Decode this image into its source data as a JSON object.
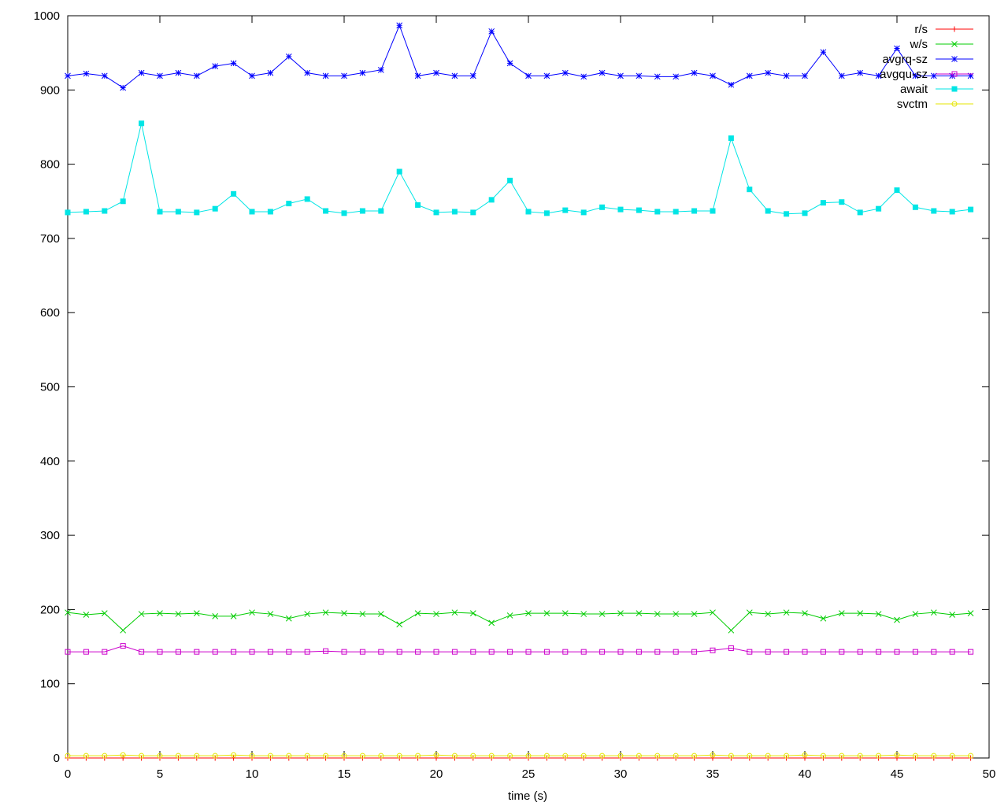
{
  "chart_data": {
    "type": "line",
    "title": "",
    "xlabel": "time (s)",
    "ylabel": "",
    "xlim": [
      0,
      50
    ],
    "ylim": [
      0,
      1000
    ],
    "xticks": [
      0,
      5,
      10,
      15,
      20,
      25,
      30,
      35,
      40,
      45,
      50
    ],
    "yticks": [
      0,
      100,
      200,
      300,
      400,
      500,
      600,
      700,
      800,
      900,
      1000
    ],
    "grid": false,
    "legend_position": "top-right",
    "x": [
      0,
      1,
      2,
      3,
      4,
      5,
      6,
      7,
      8,
      9,
      10,
      11,
      12,
      13,
      14,
      15,
      16,
      17,
      18,
      19,
      20,
      21,
      22,
      23,
      24,
      25,
      26,
      27,
      28,
      29,
      30,
      31,
      32,
      33,
      34,
      35,
      36,
      37,
      38,
      39,
      40,
      41,
      42,
      43,
      44,
      45,
      46,
      47,
      48,
      49
    ],
    "series": [
      {
        "name": "r/s",
        "color": "#ff0000",
        "marker": "plus",
        "values": [
          0,
          0,
          0,
          0,
          0,
          0,
          0,
          0,
          0,
          0,
          0,
          0,
          0,
          0,
          0,
          0,
          0,
          0,
          0,
          0,
          0,
          0,
          0,
          0,
          0,
          0,
          0,
          0,
          0,
          0,
          0,
          0,
          0,
          0,
          0,
          0,
          0,
          0,
          0,
          0,
          0,
          0,
          0,
          0,
          0,
          0,
          0,
          0,
          0,
          0
        ]
      },
      {
        "name": "w/s",
        "color": "#00cc00",
        "marker": "x",
        "values": [
          196,
          193,
          195,
          172,
          194,
          195,
          194,
          195,
          191,
          191,
          196,
          194,
          188,
          194,
          196,
          195,
          194,
          194,
          180,
          195,
          194,
          196,
          195,
          182,
          192,
          195,
          195,
          195,
          194,
          194,
          195,
          195,
          194,
          194,
          194,
          196,
          172,
          196,
          194,
          196,
          195,
          188,
          195,
          195,
          194,
          186,
          194,
          196,
          193,
          195
        ]
      },
      {
        "name": "avgrq-sz",
        "color": "#0000ff",
        "marker": "star",
        "values": [
          919,
          922,
          919,
          903,
          923,
          919,
          923,
          919,
          932,
          936,
          919,
          923,
          945,
          923,
          919,
          919,
          923,
          927,
          987,
          919,
          923,
          919,
          919,
          979,
          936,
          919,
          919,
          923,
          918,
          923,
          919,
          919,
          918,
          918,
          923,
          919,
          907,
          919,
          923,
          919,
          919,
          951,
          919,
          923,
          919,
          956,
          919,
          919,
          919,
          919
        ]
      },
      {
        "name": "avgqu-sz",
        "color": "#cc00cc",
        "marker": "square-open",
        "values": [
          143,
          143,
          143,
          151,
          143,
          143,
          143,
          143,
          143,
          143,
          143,
          143,
          143,
          143,
          144,
          143,
          143,
          143,
          143,
          143,
          143,
          143,
          143,
          143,
          143,
          143,
          143,
          143,
          143,
          143,
          143,
          143,
          143,
          143,
          143,
          145,
          148,
          143,
          143,
          143,
          143,
          143,
          143,
          143,
          143,
          143,
          143,
          143,
          143,
          143
        ]
      },
      {
        "name": "await",
        "color": "#00e5e5",
        "marker": "square-filled",
        "values": [
          735,
          736,
          737,
          750,
          855,
          736,
          736,
          735,
          740,
          760,
          736,
          736,
          747,
          753,
          737,
          734,
          737,
          737,
          790,
          745,
          735,
          736,
          735,
          752,
          778,
          736,
          734,
          738,
          735,
          742,
          739,
          738,
          736,
          736,
          737,
          737,
          835,
          766,
          737,
          733,
          734,
          748,
          749,
          735,
          740,
          765,
          742,
          737,
          736,
          739
        ]
      },
      {
        "name": "svctm",
        "color": "#e5e500",
        "marker": "circle-open",
        "values": [
          3,
          3,
          3,
          4,
          3,
          3,
          3,
          3,
          3,
          4,
          3,
          3,
          3,
          3,
          3,
          3,
          3,
          3,
          3,
          3,
          4,
          3,
          3,
          3,
          3,
          3,
          3,
          3,
          3,
          3,
          3,
          3,
          3,
          3,
          3,
          4,
          3,
          3,
          3,
          3,
          4,
          3,
          3,
          3,
          3,
          4,
          3,
          3,
          3,
          3
        ]
      }
    ]
  }
}
